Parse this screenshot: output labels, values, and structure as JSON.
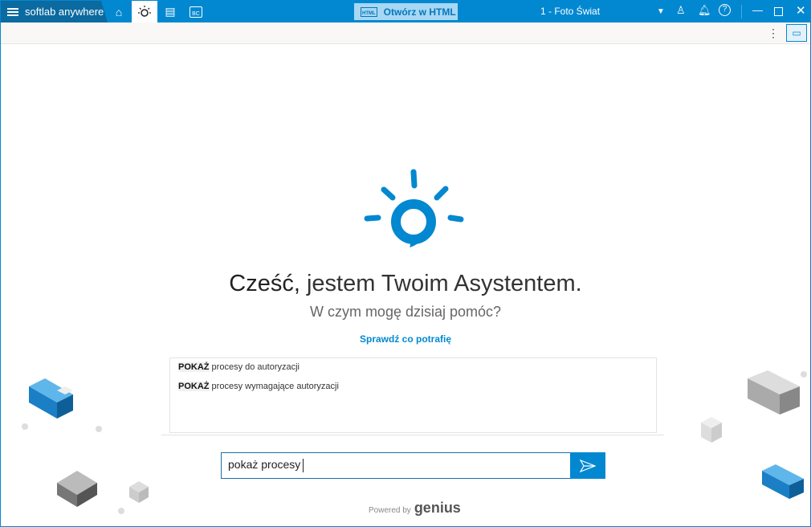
{
  "titlebar": {
    "app_name": "softlab anywhere",
    "tab_bc": "BC",
    "html_button": "Otwórz w HTML",
    "html_icon_label": "HTML",
    "company": "1 - Foto Świat"
  },
  "toolbar": {
    "kebab": "⋮"
  },
  "main": {
    "greeting_bold": "Cześć,",
    "greeting_rest": " jestem Twoim Asystentem.",
    "subtitle": "W czym mogę dzisiaj pomóc?",
    "link": "Sprawdź co potrafię"
  },
  "suggestions": [
    {
      "keyword": "POKAŻ",
      "text": " procesy do autoryzacji"
    },
    {
      "keyword": "POKAŻ",
      "text": " procesy wymagające autoryzacji"
    }
  ],
  "input": {
    "value": "pokaż procesy"
  },
  "footer": {
    "powered_by": "Powered by",
    "brand": "genius"
  },
  "colors": {
    "accent": "#0288d1",
    "brand_dark": "#0b6aa0"
  }
}
